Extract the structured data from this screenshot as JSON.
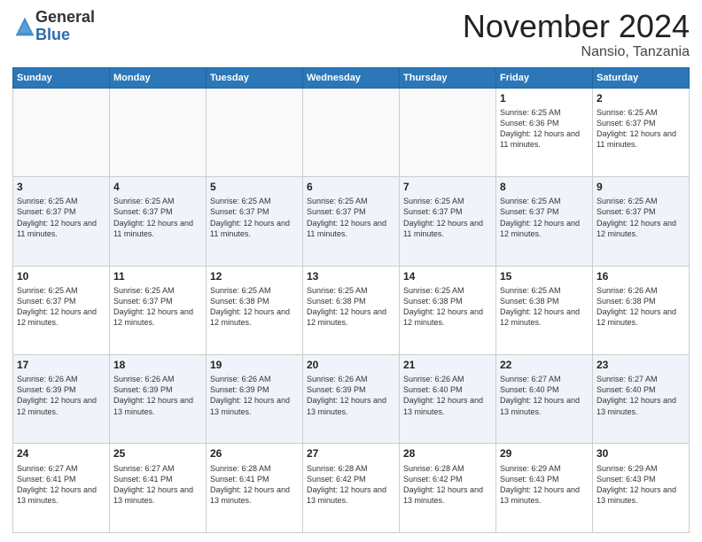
{
  "logo": {
    "general": "General",
    "blue": "Blue"
  },
  "header": {
    "month": "November 2024",
    "location": "Nansio, Tanzania"
  },
  "weekdays": [
    "Sunday",
    "Monday",
    "Tuesday",
    "Wednesday",
    "Thursday",
    "Friday",
    "Saturday"
  ],
  "weeks": [
    [
      {
        "day": "",
        "info": ""
      },
      {
        "day": "",
        "info": ""
      },
      {
        "day": "",
        "info": ""
      },
      {
        "day": "",
        "info": ""
      },
      {
        "day": "",
        "info": ""
      },
      {
        "day": "1",
        "info": "Sunrise: 6:25 AM\nSunset: 6:36 PM\nDaylight: 12 hours and 11 minutes."
      },
      {
        "day": "2",
        "info": "Sunrise: 6:25 AM\nSunset: 6:37 PM\nDaylight: 12 hours and 11 minutes."
      }
    ],
    [
      {
        "day": "3",
        "info": "Sunrise: 6:25 AM\nSunset: 6:37 PM\nDaylight: 12 hours and 11 minutes."
      },
      {
        "day": "4",
        "info": "Sunrise: 6:25 AM\nSunset: 6:37 PM\nDaylight: 12 hours and 11 minutes."
      },
      {
        "day": "5",
        "info": "Sunrise: 6:25 AM\nSunset: 6:37 PM\nDaylight: 12 hours and 11 minutes."
      },
      {
        "day": "6",
        "info": "Sunrise: 6:25 AM\nSunset: 6:37 PM\nDaylight: 12 hours and 11 minutes."
      },
      {
        "day": "7",
        "info": "Sunrise: 6:25 AM\nSunset: 6:37 PM\nDaylight: 12 hours and 11 minutes."
      },
      {
        "day": "8",
        "info": "Sunrise: 6:25 AM\nSunset: 6:37 PM\nDaylight: 12 hours and 12 minutes."
      },
      {
        "day": "9",
        "info": "Sunrise: 6:25 AM\nSunset: 6:37 PM\nDaylight: 12 hours and 12 minutes."
      }
    ],
    [
      {
        "day": "10",
        "info": "Sunrise: 6:25 AM\nSunset: 6:37 PM\nDaylight: 12 hours and 12 minutes."
      },
      {
        "day": "11",
        "info": "Sunrise: 6:25 AM\nSunset: 6:37 PM\nDaylight: 12 hours and 12 minutes."
      },
      {
        "day": "12",
        "info": "Sunrise: 6:25 AM\nSunset: 6:38 PM\nDaylight: 12 hours and 12 minutes."
      },
      {
        "day": "13",
        "info": "Sunrise: 6:25 AM\nSunset: 6:38 PM\nDaylight: 12 hours and 12 minutes."
      },
      {
        "day": "14",
        "info": "Sunrise: 6:25 AM\nSunset: 6:38 PM\nDaylight: 12 hours and 12 minutes."
      },
      {
        "day": "15",
        "info": "Sunrise: 6:25 AM\nSunset: 6:38 PM\nDaylight: 12 hours and 12 minutes."
      },
      {
        "day": "16",
        "info": "Sunrise: 6:26 AM\nSunset: 6:38 PM\nDaylight: 12 hours and 12 minutes."
      }
    ],
    [
      {
        "day": "17",
        "info": "Sunrise: 6:26 AM\nSunset: 6:39 PM\nDaylight: 12 hours and 12 minutes."
      },
      {
        "day": "18",
        "info": "Sunrise: 6:26 AM\nSunset: 6:39 PM\nDaylight: 12 hours and 13 minutes."
      },
      {
        "day": "19",
        "info": "Sunrise: 6:26 AM\nSunset: 6:39 PM\nDaylight: 12 hours and 13 minutes."
      },
      {
        "day": "20",
        "info": "Sunrise: 6:26 AM\nSunset: 6:39 PM\nDaylight: 12 hours and 13 minutes."
      },
      {
        "day": "21",
        "info": "Sunrise: 6:26 AM\nSunset: 6:40 PM\nDaylight: 12 hours and 13 minutes."
      },
      {
        "day": "22",
        "info": "Sunrise: 6:27 AM\nSunset: 6:40 PM\nDaylight: 12 hours and 13 minutes."
      },
      {
        "day": "23",
        "info": "Sunrise: 6:27 AM\nSunset: 6:40 PM\nDaylight: 12 hours and 13 minutes."
      }
    ],
    [
      {
        "day": "24",
        "info": "Sunrise: 6:27 AM\nSunset: 6:41 PM\nDaylight: 12 hours and 13 minutes."
      },
      {
        "day": "25",
        "info": "Sunrise: 6:27 AM\nSunset: 6:41 PM\nDaylight: 12 hours and 13 minutes."
      },
      {
        "day": "26",
        "info": "Sunrise: 6:28 AM\nSunset: 6:41 PM\nDaylight: 12 hours and 13 minutes."
      },
      {
        "day": "27",
        "info": "Sunrise: 6:28 AM\nSunset: 6:42 PM\nDaylight: 12 hours and 13 minutes."
      },
      {
        "day": "28",
        "info": "Sunrise: 6:28 AM\nSunset: 6:42 PM\nDaylight: 12 hours and 13 minutes."
      },
      {
        "day": "29",
        "info": "Sunrise: 6:29 AM\nSunset: 6:43 PM\nDaylight: 12 hours and 13 minutes."
      },
      {
        "day": "30",
        "info": "Sunrise: 6:29 AM\nSunset: 6:43 PM\nDaylight: 12 hours and 13 minutes."
      }
    ]
  ]
}
